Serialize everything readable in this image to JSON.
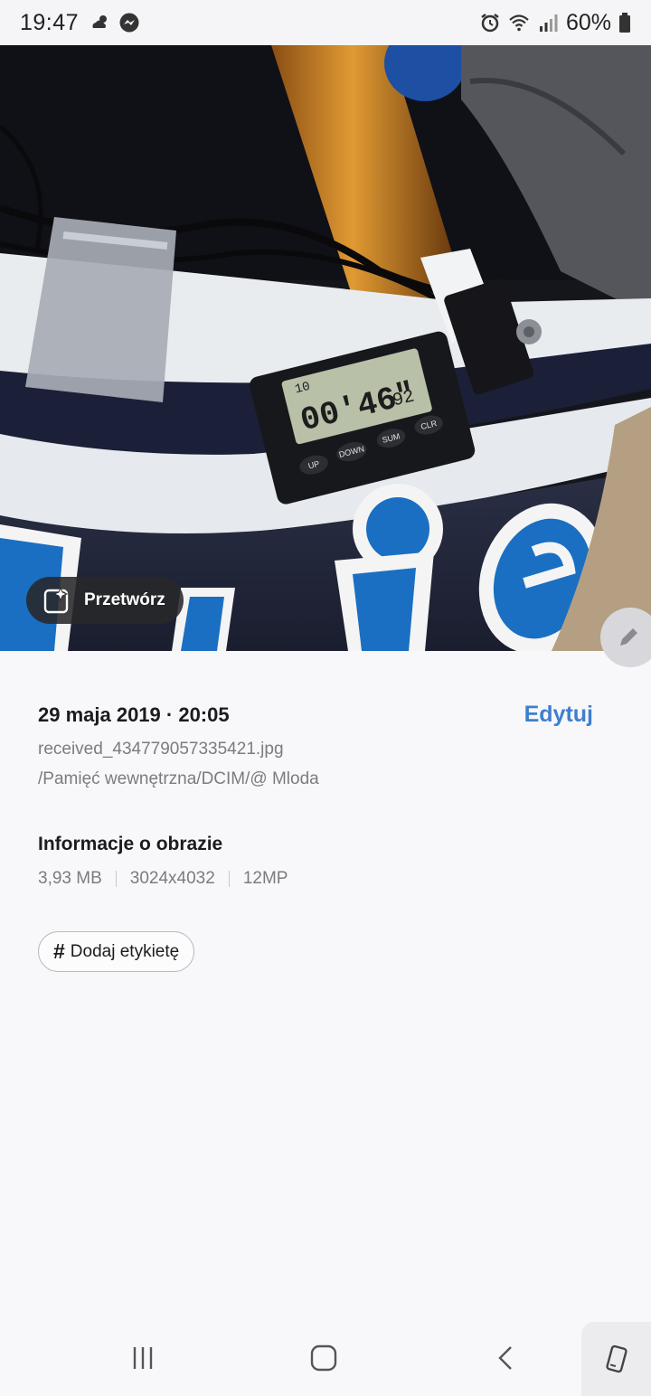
{
  "status": {
    "time": "19:47",
    "battery": "60%",
    "left_icons": [
      "weather-icon",
      "messenger-icon"
    ],
    "right_icons": [
      "alarm-icon",
      "wifi-icon",
      "signal-icon",
      "battery-icon"
    ]
  },
  "photo": {
    "remaster_label": "Przetwórz",
    "lap_counter": "10",
    "lap_time": "00'46\"",
    "lap_hundredths": "92",
    "timer_buttons": [
      "UP",
      "DOWN",
      "SUM",
      "CLR"
    ]
  },
  "details": {
    "datetime": "29 maja 2019 · 20:05",
    "edit_label": "Edytuj",
    "file_name": "received_434779057335421.jpg",
    "file_path": "/Pamięć wewnętrzna/DCIM/@ Mloda"
  },
  "image_info": {
    "heading": "Informacje o obrazie",
    "size": "3,93 MB",
    "resolution": "3024x4032",
    "megapixels": "12MP"
  },
  "tag": {
    "hash": "#",
    "label": "Dodaj etykietę"
  },
  "nav": {
    "icons": [
      "recents-icon",
      "home-icon",
      "back-icon",
      "rotate-screen-icon"
    ]
  },
  "colors": {
    "accent": "#3e7fd0",
    "background": "#f8f8fa",
    "secondary_text": "#7b7b80"
  }
}
